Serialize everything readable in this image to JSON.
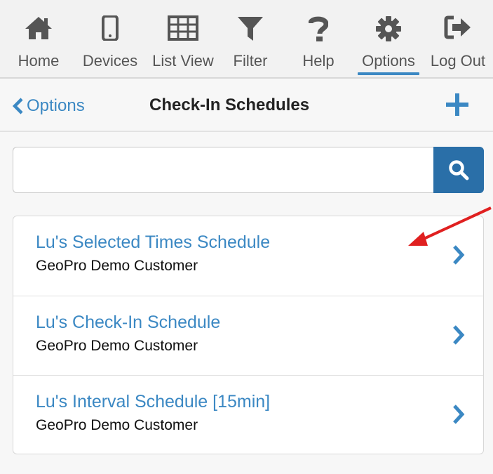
{
  "tabs": [
    {
      "label": "Home",
      "icon": "home-icon"
    },
    {
      "label": "Devices",
      "icon": "mobile-device-icon"
    },
    {
      "label": "List View",
      "icon": "grid-table-icon"
    },
    {
      "label": "Filter",
      "icon": "filter-funnel-icon"
    },
    {
      "label": "Help",
      "icon": "question-mark-icon"
    },
    {
      "label": "Options",
      "icon": "gear-icon",
      "active": true
    },
    {
      "label": "Log Out",
      "icon": "sign-out-icon"
    }
  ],
  "header": {
    "back_label": "Options",
    "title": "Check-In Schedules"
  },
  "search": {
    "value": "",
    "placeholder": ""
  },
  "schedules": [
    {
      "name": "Lu's Selected Times Schedule",
      "customer": "GeoPro Demo Customer"
    },
    {
      "name": "Lu's Check-In Schedule",
      "customer": "GeoPro Demo Customer"
    },
    {
      "name": "Lu's Interval Schedule [15min]",
      "customer": "GeoPro Demo Customer"
    }
  ],
  "colors": {
    "accent": "#3b88c3",
    "search_button": "#2a6fa8",
    "icon": "#555555",
    "annotation_arrow": "#e02020"
  }
}
